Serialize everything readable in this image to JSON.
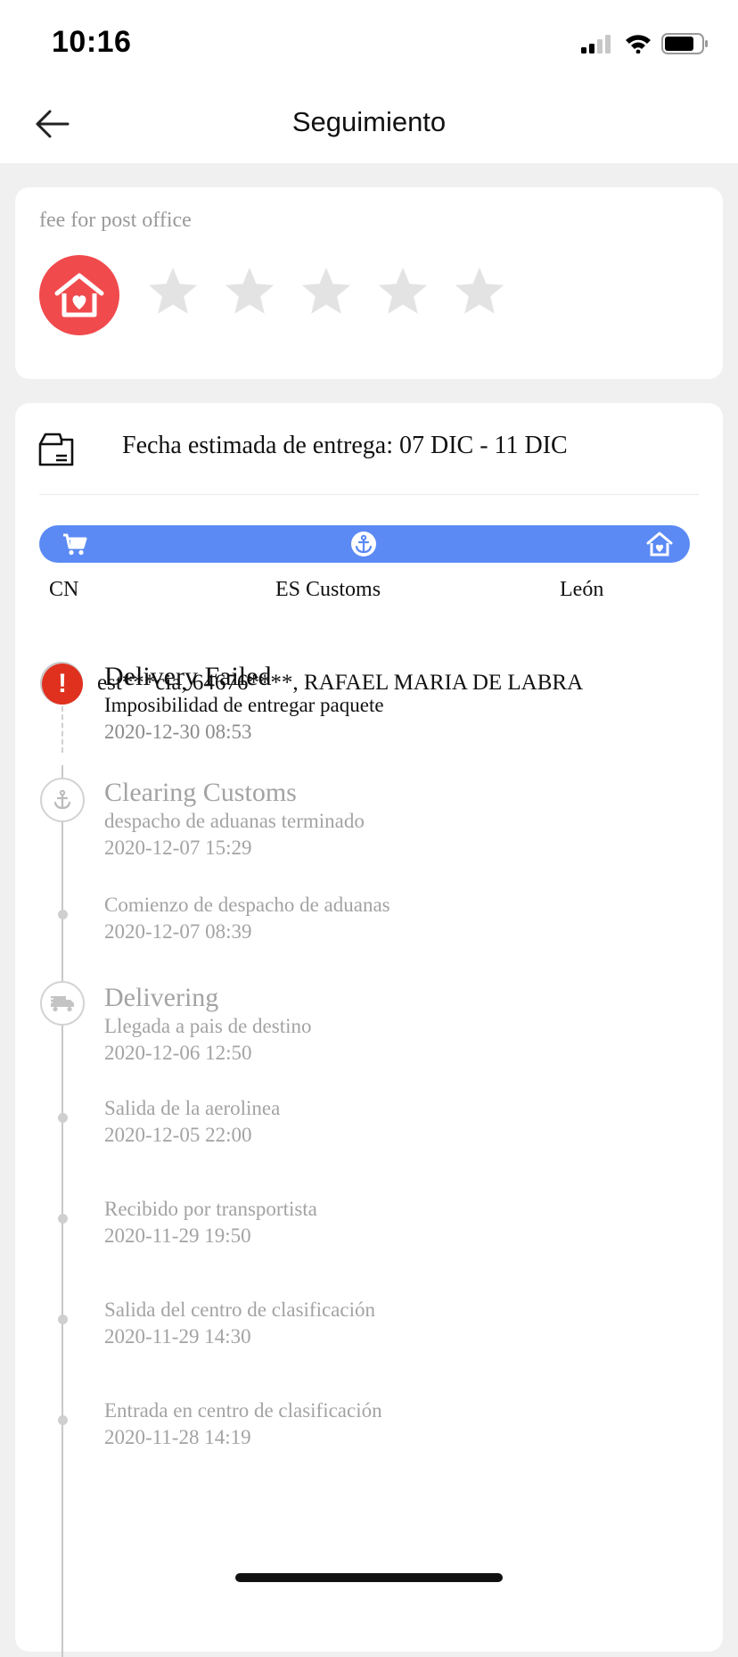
{
  "status_bar": {
    "time": "10:16"
  },
  "header": {
    "title": "Seguimiento"
  },
  "rating": {
    "label": "fee for post office",
    "stars_total": 5,
    "stars_filled": 0
  },
  "shipment": {
    "eta_text": "Fecha estimada de entrega: 07 DIC - 11 DIC",
    "progress": {
      "accent_color": "#5b8af5",
      "stages": [
        "CN",
        "ES Customs",
        "León"
      ]
    },
    "address": "est***cia,  64676****,  RAFAEL MARIA DE LABRA"
  },
  "timeline": [
    {
      "status": "Delivery Failed",
      "description": "Imposibilidad de entregar paquete",
      "datetime": "2020-12-30 08:53",
      "icon": "alert-icon",
      "color": "#e0311f"
    },
    {
      "status": "Clearing Customs",
      "description": "despacho de aduanas terminado",
      "datetime": "2020-12-07 15:29",
      "icon": "anchor-icon"
    },
    {
      "status": "",
      "description": "Comienzo de despacho de aduanas",
      "datetime": "2020-12-07 08:39",
      "icon": "dot"
    },
    {
      "status": "Delivering",
      "description": "Llegada a pais de destino",
      "datetime": "2020-12-06 12:50",
      "icon": "truck-icon"
    },
    {
      "status": "",
      "description": "Salida de la aerolinea",
      "datetime": "2020-12-05 22:00",
      "icon": "dot"
    },
    {
      "status": "",
      "description": "Recibido por transportista",
      "datetime": "2020-11-29 19:50",
      "icon": "dot"
    },
    {
      "status": "",
      "description": "Salida del centro de clasificación",
      "datetime": "2020-11-29 14:30",
      "icon": "dot"
    },
    {
      "status": "",
      "description": "Entrada en centro de clasificación",
      "datetime": "2020-11-28 14:19",
      "icon": "dot"
    }
  ]
}
